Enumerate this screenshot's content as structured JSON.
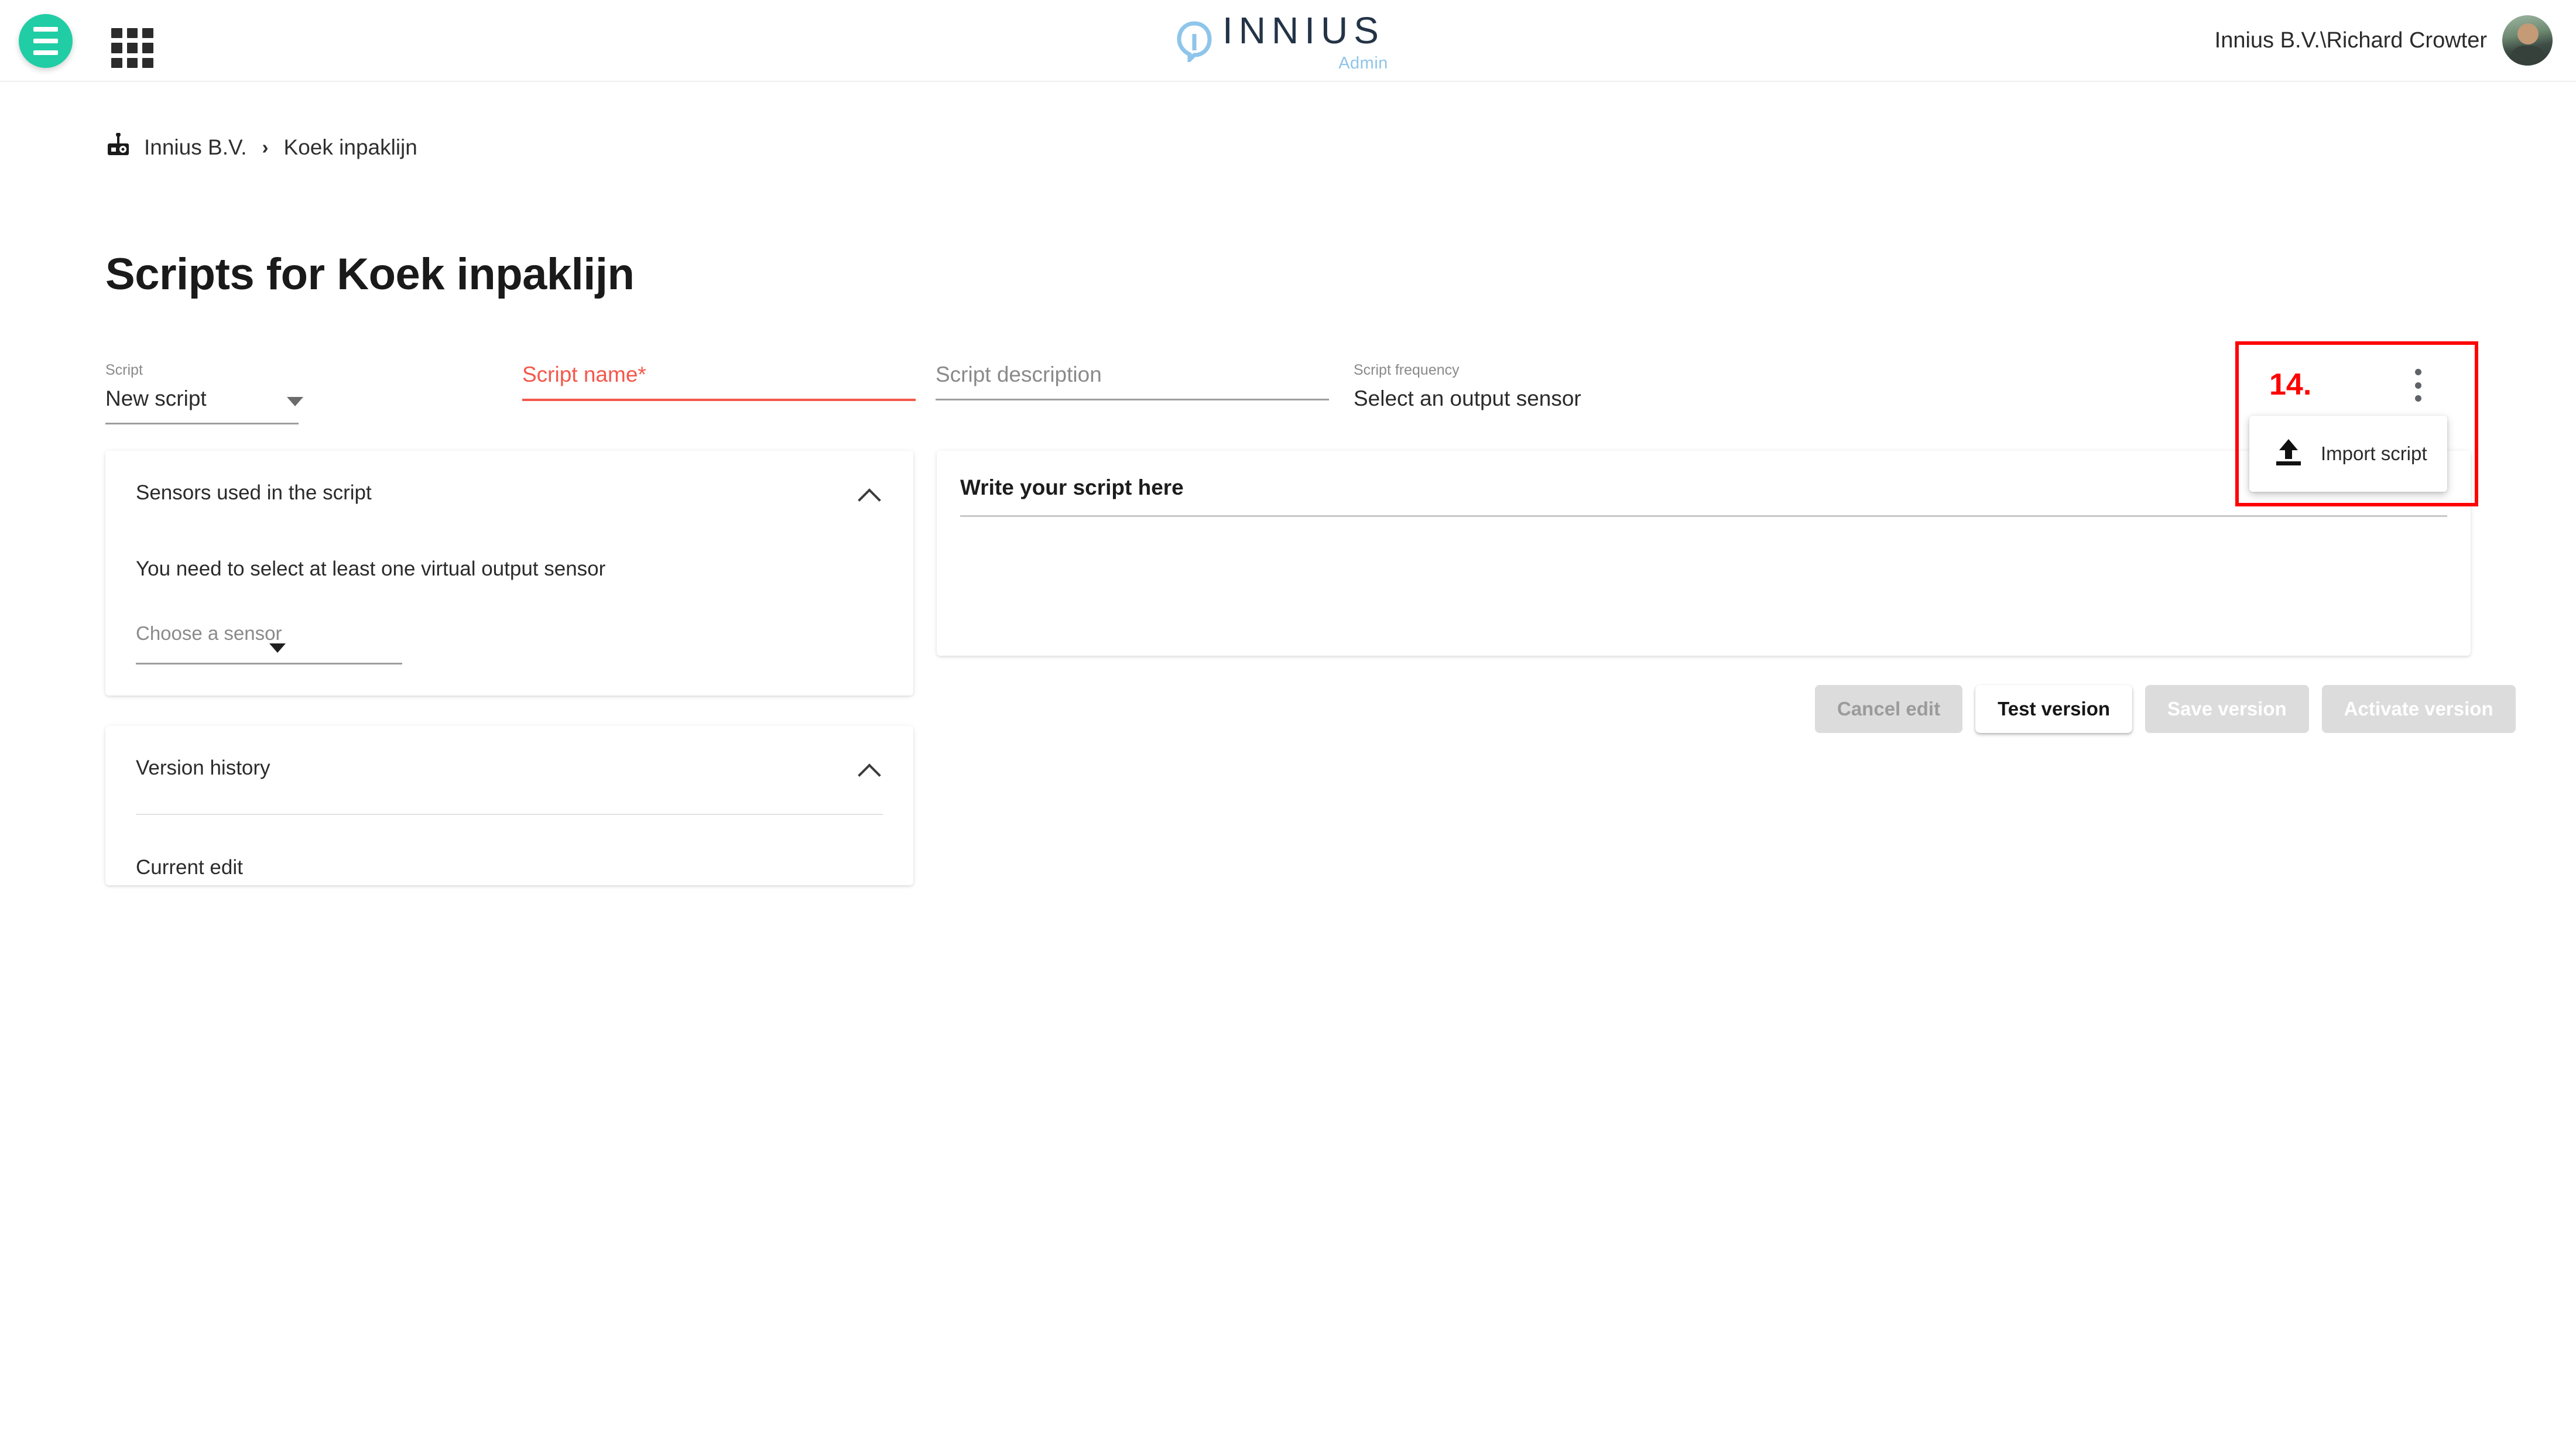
{
  "topbar": {
    "menu_icon": "hamburger-icon",
    "apps_icon": "apps-grid-icon",
    "brand_word": "INNIUS",
    "brand_sub": "Admin",
    "user_name": "Innius B.V.\\Richard Crowter",
    "accent_teal": "#20cda5",
    "brand_blue": "#8ec5ea"
  },
  "breadcrumb": {
    "icon": "machine-icon",
    "root": "Innius B.V.",
    "separator": "›",
    "current": "Koek inpaklijn"
  },
  "page": {
    "title": "Scripts for Koek inpaklijn"
  },
  "form": {
    "script": {
      "label": "Script",
      "value": "New script"
    },
    "script_name": {
      "label": "Script name*",
      "value": "",
      "error_color": "#f4584b"
    },
    "script_description": {
      "placeholder": "Script description",
      "value": ""
    },
    "script_frequency": {
      "label": "Script frequency",
      "value": "Select an output sensor"
    }
  },
  "annotation": {
    "number": "14.",
    "color": "#ff0000"
  },
  "overflow_menu": {
    "icon": "more-vert-icon",
    "items": [
      {
        "icon": "upload-icon",
        "label": "Import script"
      }
    ]
  },
  "sensors_card": {
    "title": "Sensors used in the script",
    "collapse_icon": "chevron-up-icon",
    "message": "You need to select at least one virtual output sensor",
    "select_placeholder": "Choose a sensor"
  },
  "version_card": {
    "title": "Version history",
    "collapse_icon": "chevron-up-icon",
    "items": [
      "Current edit"
    ]
  },
  "editor_card": {
    "title": "Write your script here",
    "content": ""
  },
  "actions": [
    {
      "label": "Cancel edit",
      "state": "disabled-light"
    },
    {
      "label": "Test version",
      "state": "enabled-white"
    },
    {
      "label": "Save version",
      "state": "disabled-white"
    },
    {
      "label": "Activate version",
      "state": "disabled-white"
    }
  ]
}
